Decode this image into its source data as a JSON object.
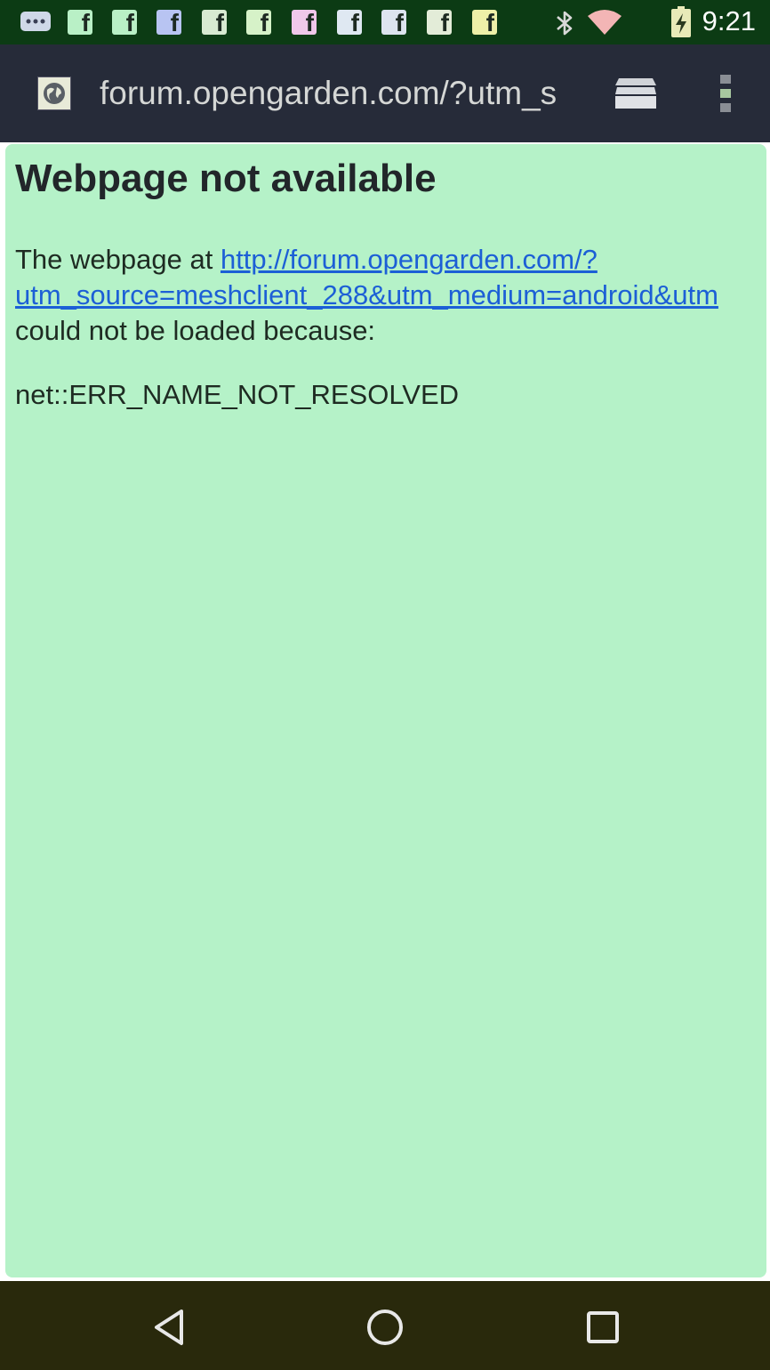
{
  "status_bar": {
    "time": "9:21",
    "notification_icons": [
      "chat-bubble-icon",
      "facebook-icon",
      "facebook-icon",
      "facebook-icon",
      "facebook-icon",
      "facebook-icon",
      "facebook-icon",
      "facebook-icon",
      "facebook-icon",
      "facebook-icon",
      "facebook-icon"
    ],
    "fb_glyph": "f",
    "system_icons": [
      "bluetooth-icon",
      "wifi-icon",
      "battery-charging-icon"
    ]
  },
  "toolbar": {
    "url": "forum.opengarden.com/?utm_s",
    "site_icon": "globe-icon",
    "tabs_icon": "tabs-icon",
    "menu_icon": "overflow-menu-icon"
  },
  "error_page": {
    "title": "Webpage not available",
    "prefix": "The webpage at ",
    "link_line1": "http://forum.opengarden.com/?",
    "link_line2": "utm_source=meshclient_288&utm_medium=android&utm",
    "suffix": "could not be loaded because:",
    "error_code": "net::ERR_NAME_NOT_RESOLVED"
  },
  "nav_bar": {
    "buttons": [
      "back-icon",
      "home-icon",
      "recents-icon"
    ]
  },
  "colors": {
    "status_bar_bg": "#0c3b14",
    "toolbar_bg": "#262b39",
    "content_bg": "#b5f2c8",
    "link": "#1c5fd6",
    "nav_bar_bg": "#29290c"
  }
}
